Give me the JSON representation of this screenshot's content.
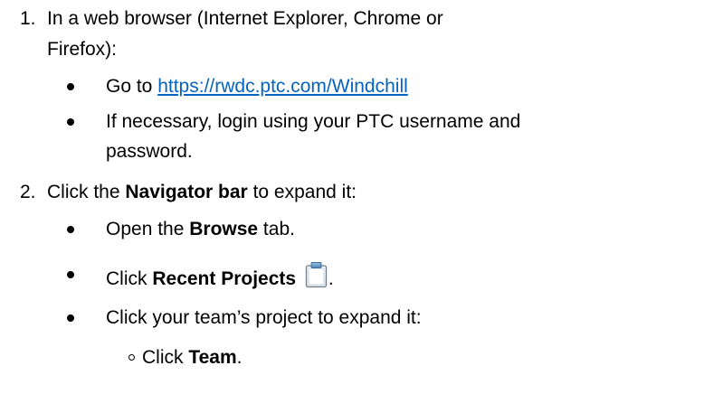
{
  "steps": [
    {
      "number": "1.",
      "line1": "In a web browser (Internet Explorer, Chrome or",
      "line2": "Firefox):",
      "bullets": [
        {
          "prefix": "Go to ",
          "link": "https://rwdc.ptc.com/Windchill"
        },
        {
          "line1": "If necessary, login using your PTC username and",
          "line2": "password."
        }
      ]
    },
    {
      "number": "2.",
      "pre": "Click the ",
      "bold": "Navigator bar",
      "post": " to expand it:",
      "bullets": [
        {
          "pre": "Open the ",
          "bold": "Browse",
          "post": " tab."
        },
        {
          "pre": "Click ",
          "bold": "Recent Projects",
          "post": "."
        },
        {
          "text": "Click your team’s project to expand it:",
          "subitems": [
            {
              "pre": "Click ",
              "bold": "Team",
              "post": "."
            }
          ]
        }
      ]
    }
  ],
  "colors": {
    "link": "#0563C1",
    "text": "#000000"
  },
  "icons": {
    "recent_projects": "clipboard-icon"
  }
}
